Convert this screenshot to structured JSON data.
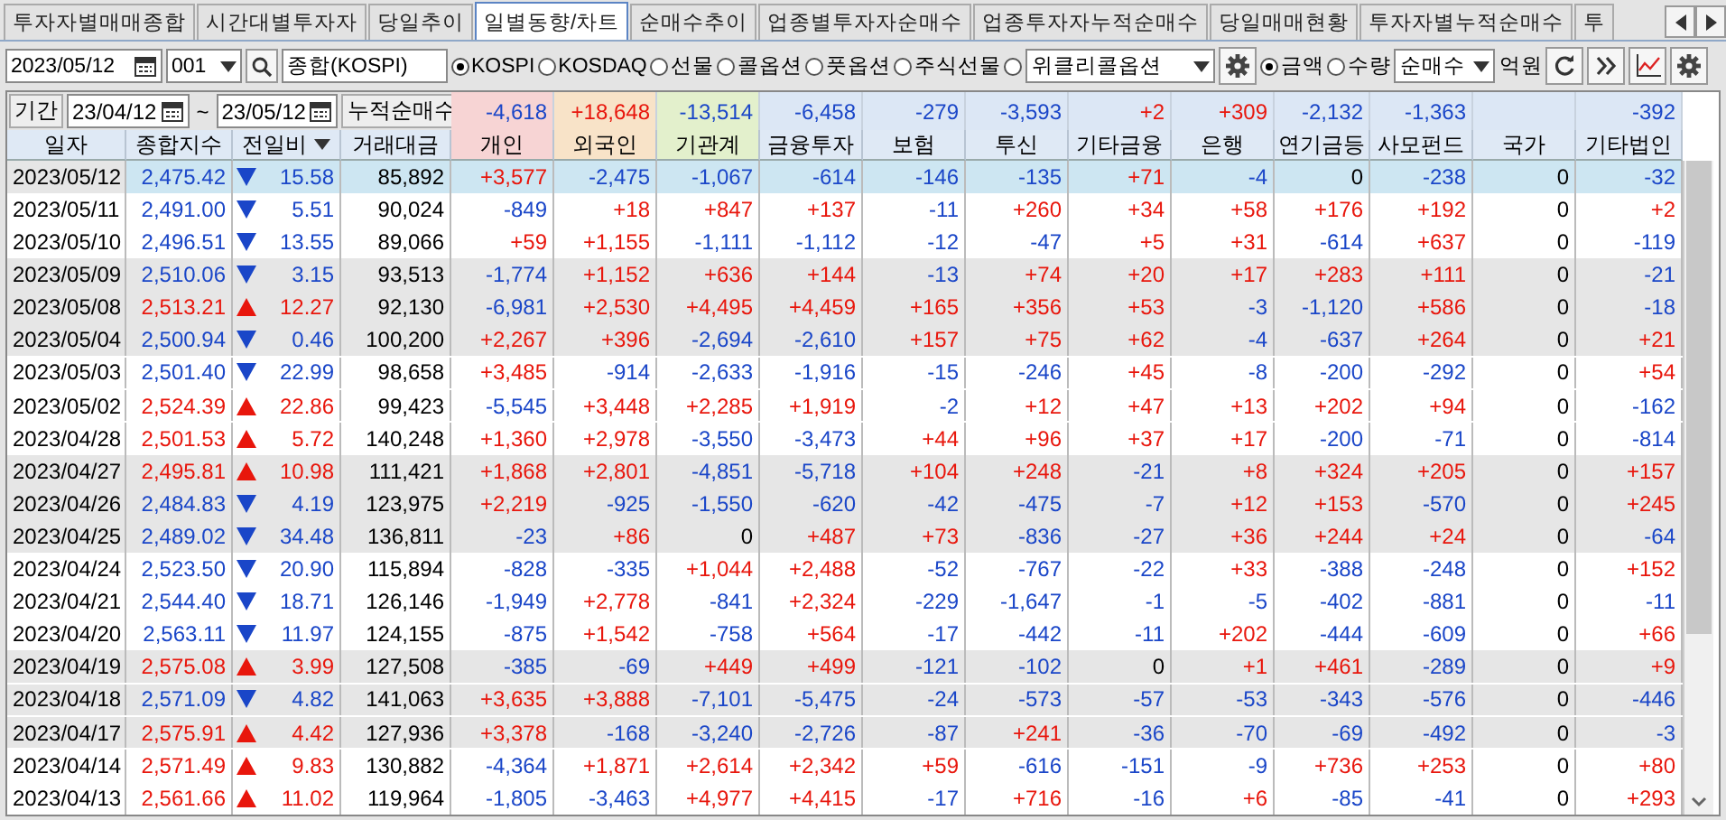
{
  "tabs": [
    {
      "label": "투자자별매매종합",
      "selected": false
    },
    {
      "label": "시간대별투자자",
      "selected": false
    },
    {
      "label": "당일추이",
      "selected": false
    },
    {
      "label": "일별동향/차트",
      "selected": true
    },
    {
      "label": "순매수추이",
      "selected": false
    },
    {
      "label": "업종별투자자순매수",
      "selected": false
    },
    {
      "label": "업종투자자누적순매수",
      "selected": false
    },
    {
      "label": "당일매매현황",
      "selected": false
    },
    {
      "label": "투자자별누적순매수",
      "selected": false
    },
    {
      "label": "투",
      "selected": false
    }
  ],
  "toolbar": {
    "date": "2023/05/12",
    "code": "001",
    "market_name": "종합(KOSPI)",
    "markets": [
      {
        "label": "KOSPI",
        "selected": true
      },
      {
        "label": "KOSDAQ",
        "selected": false
      },
      {
        "label": "선물",
        "selected": false
      },
      {
        "label": "콜옵션",
        "selected": false
      },
      {
        "label": "풋옵션",
        "selected": false
      },
      {
        "label": "주식선물",
        "selected": false
      }
    ],
    "weekly": {
      "selected": false,
      "value": "위클리콜옵션"
    },
    "units": [
      {
        "label": "금액",
        "selected": true
      },
      {
        "label": "수량",
        "selected": false
      }
    ],
    "mode": "순매수",
    "unit_label": "억원"
  },
  "period": {
    "label": "기간",
    "from": "23/04/12",
    "separator": "~",
    "to": "23/05/12",
    "cumulative_label": "누적순매수"
  },
  "columns": [
    {
      "label": "일자"
    },
    {
      "label": "종합지수"
    },
    {
      "label": "전일비"
    },
    {
      "label": "거래대금"
    },
    {
      "label": "개인",
      "color": "#f7d4d4",
      "total": "-4,618"
    },
    {
      "label": "외국인",
      "color": "#f8e3c8",
      "total": "+18,648"
    },
    {
      "label": "기관계",
      "color": "#e3f0cc",
      "total": "-13,514"
    },
    {
      "label": "금융투자",
      "total": "-6,458"
    },
    {
      "label": "보험",
      "total": "-279"
    },
    {
      "label": "투신",
      "total": "-3,593"
    },
    {
      "label": "기타금융",
      "total": "+2"
    },
    {
      "label": "은행",
      "total": "+309"
    },
    {
      "label": "연기금등",
      "total": "-2,132"
    },
    {
      "label": "사모펀드",
      "total": "-1,363"
    },
    {
      "label": "국가"
    },
    {
      "label": "기타법인",
      "total": "-392"
    }
  ],
  "rows": [
    {
      "date": "2023/05/12",
      "index": "2,475.42",
      "up": false,
      "change": "15.58",
      "amount": "85,892",
      "selected": true,
      "values": [
        "+3,577",
        "-2,475",
        "-1,067",
        "-614",
        "-146",
        "-135",
        "+71",
        "-4",
        "0",
        "-238",
        "0",
        "-32"
      ]
    },
    {
      "date": "2023/05/11",
      "index": "2,491.00",
      "up": false,
      "change": "5.51",
      "amount": "90,024",
      "selected": false,
      "values": [
        "-849",
        "+18",
        "+847",
        "+137",
        "-11",
        "+260",
        "+34",
        "+58",
        "+176",
        "+192",
        "0",
        "+2"
      ]
    },
    {
      "date": "2023/05/10",
      "index": "2,496.51",
      "up": false,
      "change": "13.55",
      "amount": "89,066",
      "selected": false,
      "values": [
        "+59",
        "+1,155",
        "-1,111",
        "-1,112",
        "-12",
        "-47",
        "+5",
        "+31",
        "-614",
        "+637",
        "0",
        "-119"
      ]
    },
    {
      "date": "2023/05/09",
      "index": "2,510.06",
      "up": false,
      "change": "3.15",
      "amount": "93,513",
      "selected": false,
      "values": [
        "-1,774",
        "+1,152",
        "+636",
        "+144",
        "-13",
        "+74",
        "+20",
        "+17",
        "+283",
        "+111",
        "0",
        "-21"
      ]
    },
    {
      "date": "2023/05/08",
      "index": "2,513.21",
      "up": true,
      "change": "12.27",
      "amount": "92,130",
      "selected": false,
      "values": [
        "-6,981",
        "+2,530",
        "+4,495",
        "+4,459",
        "+165",
        "+356",
        "+53",
        "-3",
        "-1,120",
        "+586",
        "0",
        "-18"
      ]
    },
    {
      "date": "2023/05/04",
      "index": "2,500.94",
      "up": false,
      "change": "0.46",
      "amount": "100,200",
      "selected": false,
      "values": [
        "+2,267",
        "+396",
        "-2,694",
        "-2,610",
        "+157",
        "+75",
        "+62",
        "-4",
        "-637",
        "+264",
        "0",
        "+21"
      ]
    },
    {
      "date": "2023/05/03",
      "index": "2,501.40",
      "up": false,
      "change": "22.99",
      "amount": "98,658",
      "selected": false,
      "values": [
        "+3,485",
        "-914",
        "-2,633",
        "-1,916",
        "-15",
        "-246",
        "+45",
        "-8",
        "-200",
        "-292",
        "0",
        "+54"
      ]
    },
    {
      "date": "2023/05/02",
      "index": "2,524.39",
      "up": true,
      "change": "22.86",
      "amount": "99,423",
      "selected": false,
      "values": [
        "-5,545",
        "+3,448",
        "+2,285",
        "+1,919",
        "-2",
        "+12",
        "+47",
        "+13",
        "+202",
        "+94",
        "0",
        "-162"
      ]
    },
    {
      "date": "2023/04/28",
      "index": "2,501.53",
      "up": true,
      "change": "5.72",
      "amount": "140,248",
      "selected": false,
      "values": [
        "+1,360",
        "+2,978",
        "-3,550",
        "-3,473",
        "+44",
        "+96",
        "+37",
        "+17",
        "-200",
        "-71",
        "0",
        "-814"
      ]
    },
    {
      "date": "2023/04/27",
      "index": "2,495.81",
      "up": true,
      "change": "10.98",
      "amount": "111,421",
      "selected": false,
      "values": [
        "+1,868",
        "+2,801",
        "-4,851",
        "-5,718",
        "+104",
        "+248",
        "-21",
        "+8",
        "+324",
        "+205",
        "0",
        "+157"
      ]
    },
    {
      "date": "2023/04/26",
      "index": "2,484.83",
      "up": false,
      "change": "4.19",
      "amount": "123,975",
      "selected": false,
      "values": [
        "+2,219",
        "-925",
        "-1,550",
        "-620",
        "-42",
        "-475",
        "-7",
        "+12",
        "+153",
        "-570",
        "0",
        "+245"
      ]
    },
    {
      "date": "2023/04/25",
      "index": "2,489.02",
      "up": false,
      "change": "34.48",
      "amount": "136,811",
      "selected": false,
      "values": [
        "-23",
        "+86",
        "0",
        "+487",
        "+73",
        "-836",
        "-27",
        "+36",
        "+244",
        "+24",
        "0",
        "-64"
      ]
    },
    {
      "date": "2023/04/24",
      "index": "2,523.50",
      "up": false,
      "change": "20.90",
      "amount": "115,894",
      "selected": false,
      "values": [
        "-828",
        "-335",
        "+1,044",
        "+2,488",
        "-52",
        "-767",
        "-22",
        "+33",
        "-388",
        "-248",
        "0",
        "+152"
      ]
    },
    {
      "date": "2023/04/21",
      "index": "2,544.40",
      "up": false,
      "change": "18.71",
      "amount": "126,146",
      "selected": false,
      "values": [
        "-1,949",
        "+2,778",
        "-841",
        "+2,324",
        "-229",
        "-1,647",
        "-1",
        "-5",
        "-402",
        "-881",
        "0",
        "-11"
      ]
    },
    {
      "date": "2023/04/20",
      "index": "2,563.11",
      "up": false,
      "change": "11.97",
      "amount": "124,155",
      "selected": false,
      "values": [
        "-875",
        "+1,542",
        "-758",
        "+564",
        "-17",
        "-442",
        "-11",
        "+202",
        "-444",
        "-609",
        "0",
        "+66"
      ]
    },
    {
      "date": "2023/04/19",
      "index": "2,575.08",
      "up": true,
      "change": "3.99",
      "amount": "127,508",
      "selected": false,
      "values": [
        "-385",
        "-69",
        "+449",
        "+499",
        "-121",
        "-102",
        "0",
        "+1",
        "+461",
        "-289",
        "0",
        "+9"
      ]
    },
    {
      "date": "2023/04/18",
      "index": "2,571.09",
      "up": false,
      "change": "4.82",
      "amount": "141,063",
      "selected": false,
      "values": [
        "+3,635",
        "+3,888",
        "-7,101",
        "-5,475",
        "-24",
        "-573",
        "-57",
        "-53",
        "-343",
        "-576",
        "0",
        "-446"
      ]
    },
    {
      "date": "2023/04/17",
      "index": "2,575.91",
      "up": true,
      "change": "4.42",
      "amount": "127,936",
      "selected": false,
      "values": [
        "+3,378",
        "-168",
        "-3,240",
        "-2,726",
        "-87",
        "+241",
        "-36",
        "-70",
        "-69",
        "-492",
        "0",
        "-3"
      ]
    },
    {
      "date": "2023/04/14",
      "index": "2,571.49",
      "up": true,
      "change": "9.83",
      "amount": "130,882",
      "selected": false,
      "values": [
        "-4,364",
        "+1,871",
        "+2,614",
        "+2,342",
        "+59",
        "-616",
        "-151",
        "-9",
        "+736",
        "+253",
        "0",
        "+80"
      ]
    },
    {
      "date": "2023/04/13",
      "index": "2,561.66",
      "up": true,
      "change": "11.02",
      "amount": "119,964",
      "selected": false,
      "values": [
        "-1,805",
        "-3,463",
        "+4,977",
        "+4,415",
        "-17",
        "+716",
        "-16",
        "+6",
        "-85",
        "-41",
        "0",
        "+293"
      ]
    }
  ]
}
